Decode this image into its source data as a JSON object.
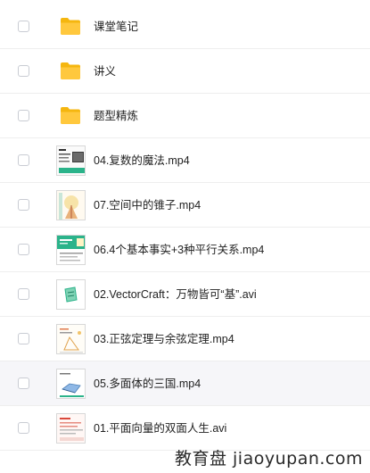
{
  "files": [
    {
      "name": "课堂笔记",
      "type": "folder"
    },
    {
      "name": "讲义",
      "type": "folder"
    },
    {
      "name": "题型精炼",
      "type": "folder"
    },
    {
      "name": "04.复数的魔法.mp4",
      "type": "video",
      "thumb": "thumb-lecture-slide"
    },
    {
      "name": "07.空间中的锥子.mp4",
      "type": "video",
      "thumb": "thumb-cone-illustration"
    },
    {
      "name": "06.4个基本事实+3种平行关系.mp4",
      "type": "video",
      "thumb": "thumb-green-banner"
    },
    {
      "name": "02.VectorCraft：万物皆可“基”.avi",
      "type": "video",
      "thumb": "thumb-green-shape"
    },
    {
      "name": "03.正弦定理与余弦定理.mp4",
      "type": "video",
      "thumb": "thumb-triangle-slide"
    },
    {
      "name": "05.多面体的三国.mp4",
      "type": "video",
      "thumb": "thumb-polyhedron-slide"
    },
    {
      "name": "01.平面向量的双面人生.avi",
      "type": "video",
      "thumb": "thumb-red-slide"
    }
  ],
  "hover_row_index": 8,
  "colors": {
    "folder": "#ffc83d",
    "folder_dark": "#f5b60f",
    "accent_green": "#2bb38a"
  },
  "watermark": "教育盘 jiaoyupan.com"
}
